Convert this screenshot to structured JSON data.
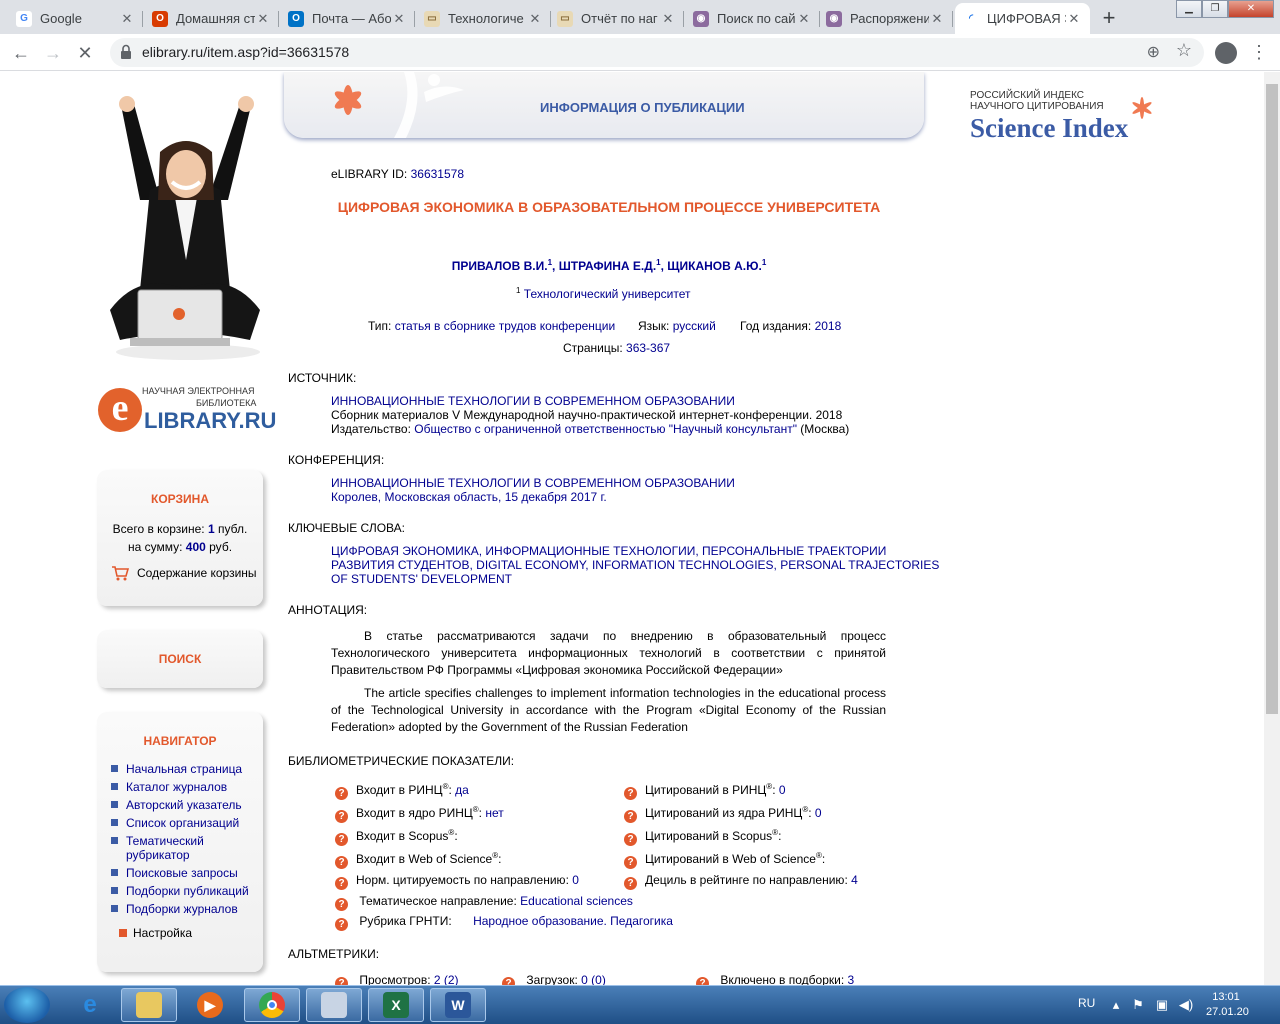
{
  "browser": {
    "tabs": [
      {
        "title": "Google",
        "fav_color": "#ffffff",
        "fav_glyph": "G",
        "fav_text": "#4285f4"
      },
      {
        "title": "Домашняя ст",
        "fav_color": "#d83b01",
        "fav_glyph": "О",
        "fav_text": "#ffffff"
      },
      {
        "title": "Почта — Абон",
        "fav_color": "#0072c6",
        "fav_glyph": "O",
        "fav_text": "#ffffff"
      },
      {
        "title": "Технологиче",
        "fav_color": "#e8d9b5",
        "fav_glyph": "▭",
        "fav_text": "#8a6d3b"
      },
      {
        "title": "Отчёт по наг",
        "fav_color": "#e8d9b5",
        "fav_glyph": "▭",
        "fav_text": "#8a6d3b"
      },
      {
        "title": "Поиск по сай",
        "fav_color": "#8c6b9e",
        "fav_glyph": "◉",
        "fav_text": "#ffffff"
      },
      {
        "title": "Распоряжени",
        "fav_color": "#8c6b9e",
        "fav_glyph": "◉",
        "fav_text": "#ffffff"
      },
      {
        "title": "ЦИФРОВАЯ Э",
        "fav_color": "#ffffff",
        "fav_glyph": "◜",
        "fav_text": "#1a73e8",
        "active": true
      }
    ],
    "url": "elibrary.ru/item.asp?id=36631578"
  },
  "page": {
    "banner_title": "ИНФОРМАЦИЯ О ПУБЛИКАЦИИ",
    "science_index": {
      "line1": "РОССИЙСКИЙ ИНДЕКС",
      "line2": "НАУЧНОГО ЦИТИРОВАНИЯ",
      "brand": "Science Index"
    },
    "logo": {
      "tag1": "НАУЧНАЯ ЭЛЕКТРОННАЯ",
      "tag2": "БИБЛИОТЕКА",
      "brand": "LIBRARY.RU",
      "letter": "e"
    },
    "cart": {
      "title": "КОРЗИНА",
      "total_label": "Всего в корзине:",
      "total_value": "1",
      "total_unit": "публ.",
      "sum_label": "на сумму:",
      "sum_value": "400",
      "sum_unit": "руб.",
      "content_link": "Содержание корзины"
    },
    "search": {
      "title": "ПОИСК"
    },
    "navigator": {
      "title": "НАВИГАТОР",
      "items": [
        "Начальная страница",
        "Каталог журналов",
        "Авторский указатель",
        "Список организаций",
        "Тематический рубрикатор",
        "Поисковые запросы",
        "Подборки публикаций",
        "Подборки журналов"
      ],
      "settings": "Настройка"
    },
    "elibrary_id_label": "eLIBRARY ID:",
    "elibrary_id": "36631578",
    "title": "ЦИФРОВАЯ ЭКОНОМИКА В ОБРАЗОВАТЕЛЬНОМ ПРОЦЕССЕ УНИВЕРСИТЕТА",
    "authors": [
      {
        "name": "ПРИВАЛОВ В.И.",
        "sup": "1"
      },
      {
        "name": "ШТРАФИНА Е.Д.",
        "sup": "1"
      },
      {
        "name": "ЩИКАНОВ А.Ю.",
        "sup": "1"
      }
    ],
    "affiliation": {
      "sup": "1",
      "name": "Технологический университет"
    },
    "meta": {
      "type_label": "Тип:",
      "type_value": "статья в сборнике трудов конференции",
      "lang_label": "Язык:",
      "lang_value": "русский",
      "year_label": "Год издания:",
      "year_value": "2018",
      "pages_label": "Страницы:",
      "pages_value": "363-367"
    },
    "source": {
      "heading": "ИСТОЧНИК:",
      "name": "ИННОВАЦИОННЫЕ ТЕХНОЛОГИИ В СОВРЕМЕННОМ ОБРАЗОВАНИИ",
      "desc": "Сборник материалов V Международной научно-практической интернет-конференции. 2018",
      "publisher_label": "Издательство:",
      "publisher": "Общество с ограниченной ответственностью \"Научный консультант\"",
      "city": "(Москва)"
    },
    "conference": {
      "heading": "КОНФЕРЕНЦИЯ:",
      "name": "ИННОВАЦИОННЫЕ ТЕХНОЛОГИИ В СОВРЕМЕННОМ ОБРАЗОВАНИИ",
      "place": "Королев, Московская область, 15 декабря 2017 г."
    },
    "keywords": {
      "heading": "КЛЮЧЕВЫЕ СЛОВА:",
      "line1": "ЦИФРОВАЯ ЭКОНОМИКА, ИНФОРМАЦИОННЫЕ ТЕХНОЛОГИИ, ПЕРСОНАЛЬНЫЕ ТРАЕКТОРИИ",
      "line2": "РАЗВИТИЯ СТУДЕНТОВ, DIGITAL ECONOMY, INFORMATION TECHNOLOGIES, PERSONAL TRAJECTORIES",
      "line3": "OF STUDENTS' DEVELOPMENT"
    },
    "annotation": {
      "heading": "АННОТАЦИЯ:",
      "ru": "В статье рассматриваются задачи по внедрению в образовательный процесс Технологического университета информационных технологий в соответствии с принятой Правительством РФ Программы «Цифровая экономика Российской Федерации»",
      "en": "The article specifies challenges to implement information technologies in the educational process of the Technological University in accordance with the Program «Digital Economy of the Russian Federation» adopted by the Government of the Russian Federation"
    },
    "biblio": {
      "heading": "БИБЛИОМЕТРИЧЕСКИЕ ПОКАЗАТЕЛИ:",
      "left": [
        {
          "label": "Входит в РИНЦ",
          "sup": "®",
          "value": "да"
        },
        {
          "label": "Входит в ядро РИНЦ",
          "sup": "®",
          "value": "нет"
        },
        {
          "label": "Входит в Scopus",
          "sup": "®",
          "value": ""
        },
        {
          "label": "Входит в Web of Science",
          "sup": "®",
          "value": ""
        },
        {
          "label": "Норм. цитируемость по направлению",
          "sup": "",
          "value": "0"
        }
      ],
      "right": [
        {
          "label": "Цитирований в РИНЦ",
          "sup": "®",
          "value": "0"
        },
        {
          "label": "Цитирований из ядра РИНЦ",
          "sup": "®",
          "value": "0"
        },
        {
          "label": "Цитирований в Scopus",
          "sup": "®",
          "value": ""
        },
        {
          "label": "Цитирований в Web of Science",
          "sup": "®",
          "value": ""
        },
        {
          "label": "Дециль в рейтинге по направлению",
          "sup": "",
          "value": "4"
        }
      ],
      "theme_label": "Тематическое направление:",
      "theme_value": "Educational sciences",
      "grnti_label": "Рубрика ГРНТИ:",
      "grnti_value": "Народное образование. Педагогика"
    },
    "altmetrics": {
      "heading": "АЛЬТМЕТРИКИ:",
      "views_label": "Просмотров:",
      "views_value": "2 (2)",
      "downloads_label": "Загрузок:",
      "downloads_value": "0 (0)",
      "collections_label": "Включено в подборки:",
      "collections_value": "3"
    }
  },
  "taskbar": {
    "lang": "RU",
    "time": "13:01",
    "date": "27.01.20"
  },
  "colors": {
    "accent": "#e2582c",
    "link": "#00008f",
    "brand_blue": "#3b5ba5"
  }
}
